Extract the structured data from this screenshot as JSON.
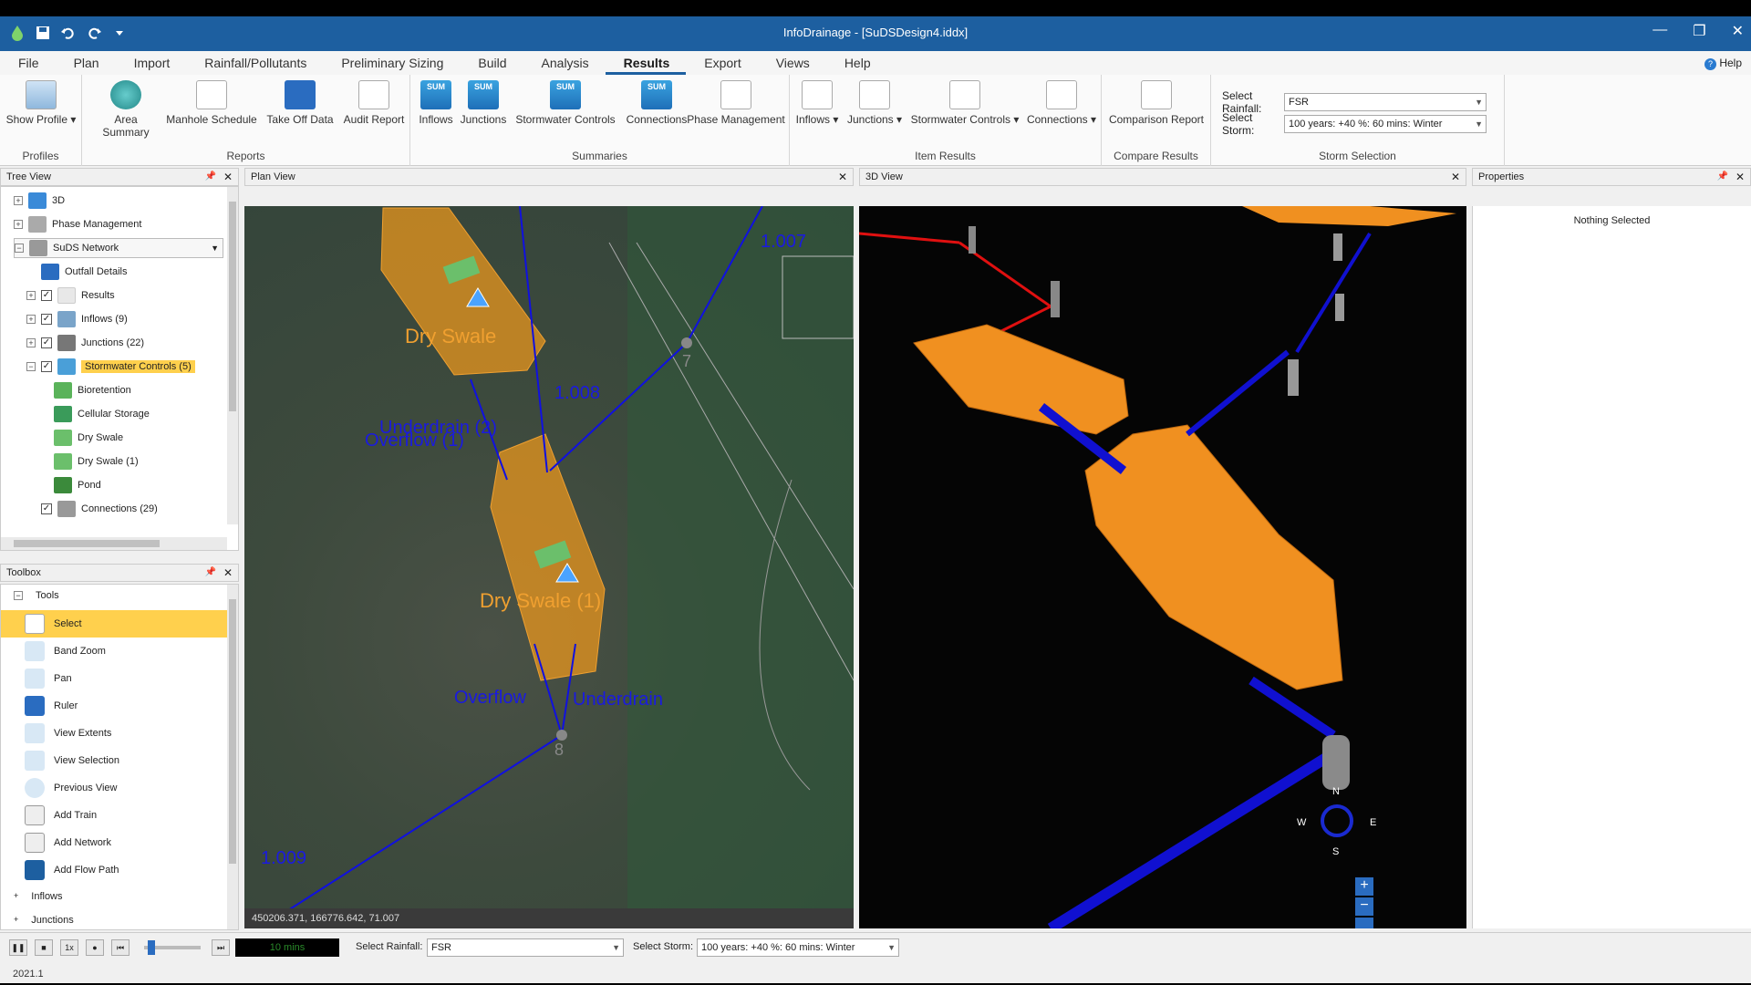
{
  "app": {
    "title": "InfoDrainage - [SuDSDesign4.iddx]",
    "version": "2021.1"
  },
  "menu": {
    "items": [
      "File",
      "Plan",
      "Import",
      "Rainfall/Pollutants",
      "Preliminary Sizing",
      "Build",
      "Analysis",
      "Results",
      "Export",
      "Views",
      "Help"
    ],
    "active": "Results",
    "help_label": "Help"
  },
  "ribbon": {
    "groups": {
      "profiles": {
        "label": "Profiles",
        "show_profile": "Show Profile"
      },
      "reports": {
        "label": "Reports",
        "area_summary": "Area Summary",
        "manhole_schedule": "Manhole Schedule",
        "take_off_data": "Take Off Data",
        "audit_report": "Audit Report"
      },
      "summaries": {
        "label": "Summaries",
        "inflows": "Inflows",
        "junctions": "Junctions",
        "stormwater_controls": "Stormwater Controls",
        "connections": "Connections",
        "phase_management": "Phase Management",
        "sum_badge": "SUM"
      },
      "item_results": {
        "label": "Item Results",
        "inflows": "Inflows",
        "junctions": "Junctions",
        "stormwater_controls": "Stormwater Controls",
        "connections": "Connections"
      },
      "compare_results": {
        "label": "Compare Results",
        "comparison_report": "Comparison Report"
      },
      "storm_selection": {
        "label": "Storm Selection",
        "select_rainfall_label": "Select Rainfall:",
        "select_rainfall_value": "FSR",
        "select_storm_label": "Select Storm:",
        "select_storm_value": "100 years: +40 %: 60 mins: Winter"
      }
    }
  },
  "tree_view": {
    "title": "Tree View",
    "items": [
      "3D",
      "Phase Management",
      "SuDS Network",
      "Outfall Details",
      "Results",
      "Inflows (9)",
      "Junctions (22)",
      "Stormwater Controls (5)",
      "Bioretention",
      "Cellular Storage",
      "Dry Swale",
      "Dry Swale (1)",
      "Pond",
      "Connections (29)"
    ]
  },
  "toolbox": {
    "title": "Toolbox",
    "section": "Tools",
    "tools": [
      "Select",
      "Band Zoom",
      "Pan",
      "Ruler",
      "View Extents",
      "View Selection",
      "Previous View",
      "Add Train",
      "Add Network",
      "Add Flow Path"
    ],
    "footer_sections": [
      "Inflows",
      "Junctions"
    ]
  },
  "plan_view": {
    "title": "Plan View",
    "labels": {
      "dry_swale": "Dry Swale",
      "dry_swale_1": "Dry Swale (1)",
      "conn_1007": "1.007",
      "conn_1008": "1.008",
      "conn_1009": "1.009",
      "underdrain_2": "Underdrain (2)",
      "overflow_1": "Overflow (1)",
      "overflow": "Overflow",
      "underdrain": "Underdrain",
      "node_7": "7",
      "node_8": "8"
    },
    "coordinates": "450206.371, 166776.642, 71.007"
  },
  "view_3d": {
    "title": "3D View",
    "compass": {
      "n": "N",
      "s": "S",
      "e": "E",
      "w": "W"
    }
  },
  "properties": {
    "title": "Properties",
    "status": "Nothing Selected"
  },
  "bottom_bar": {
    "speed": "1x",
    "time": "10 mins",
    "select_rainfall_label": "Select Rainfall:",
    "select_rainfall_value": "FSR",
    "select_storm_label": "Select Storm:",
    "select_storm_value": "100 years: +40 %: 60 mins: Winter"
  },
  "colors": {
    "title_bar": "#1d5fa0",
    "swale_orange": "#e8961e",
    "pipe_blue": "#1010e0",
    "highlight": "#ffd04d"
  }
}
